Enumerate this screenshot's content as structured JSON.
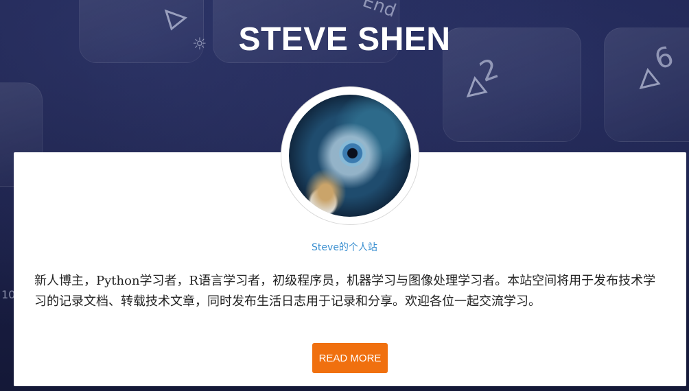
{
  "header": {
    "title": "STEVE SHEN"
  },
  "profile": {
    "subtitle": "Steve的个人站",
    "description": "新人博主，Python学习者，R语言学习者，初级程序员，机器学习与图像处理学习者。本站空间将用于发布技术学习的记录文档、转载技术文章，同时发布生活日志用于记录和分享。欢迎各位一起交流学习。",
    "read_more_label": "READ MORE"
  },
  "background_keys": [
    "2",
    "6",
    "End",
    "10"
  ],
  "colors": {
    "accent": "#f0700f",
    "link": "#3a8fd0",
    "hero_bg": "#1c2145"
  }
}
